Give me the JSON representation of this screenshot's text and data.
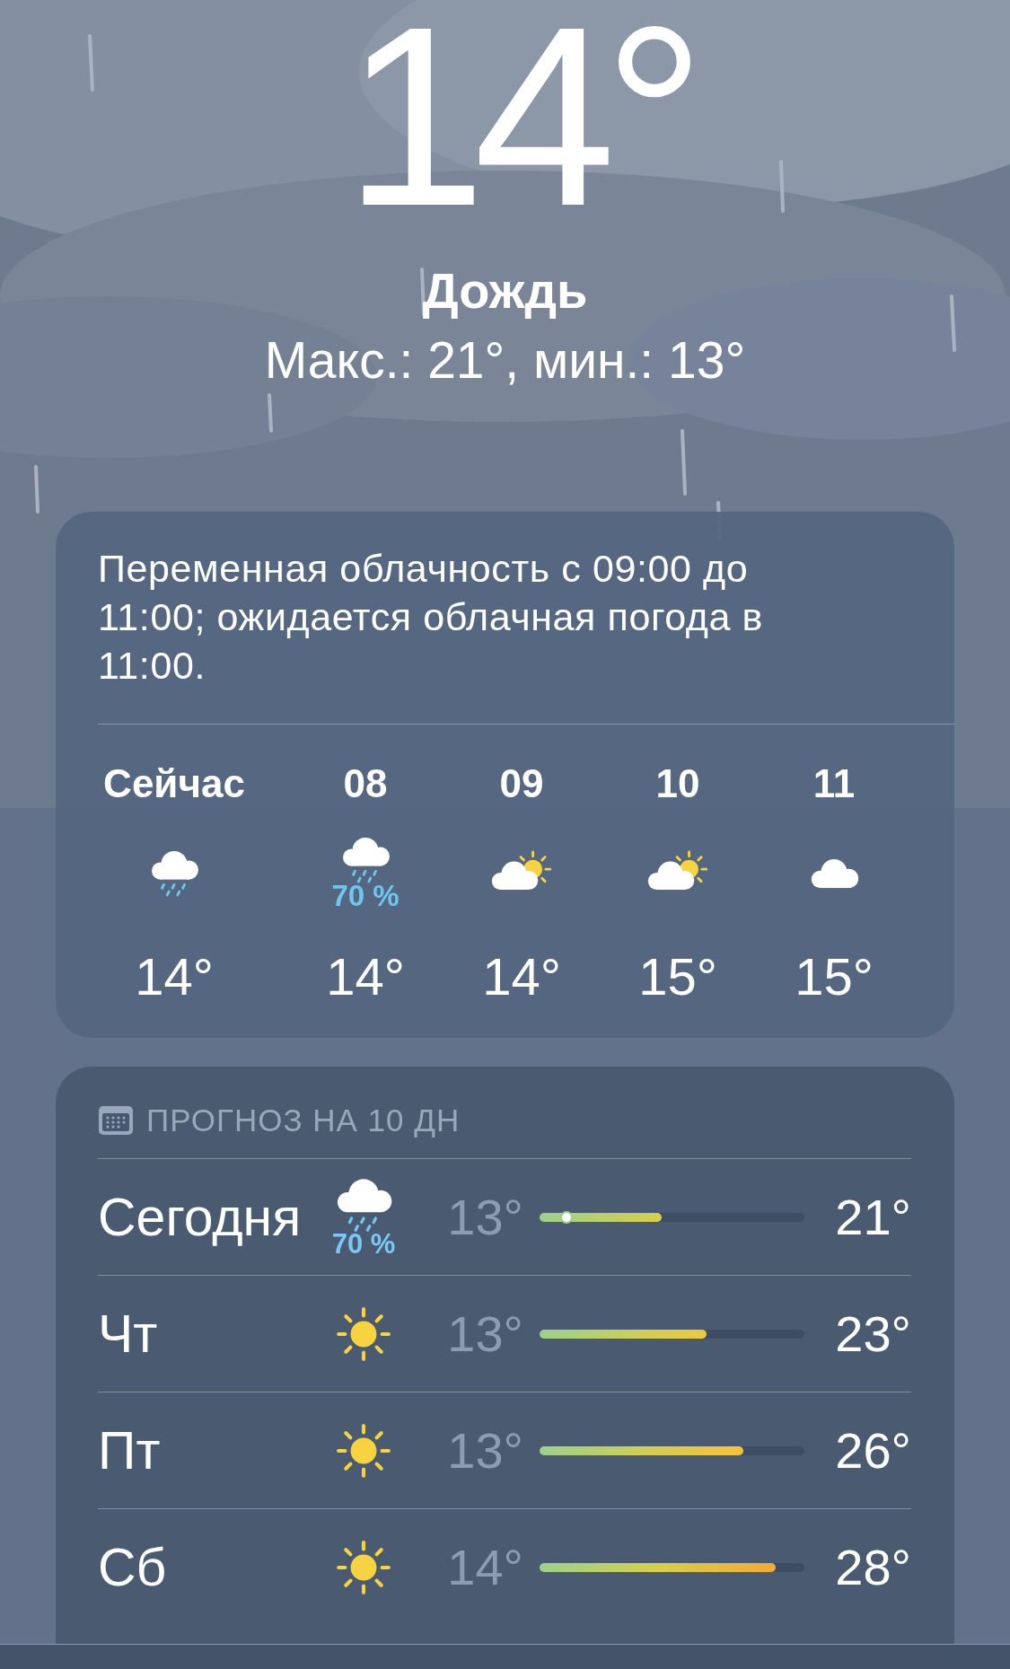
{
  "current": {
    "temperature": "14°",
    "condition": "Дождь",
    "high_low": "Макс.: 21°, мин.: 13°"
  },
  "hourly": {
    "summary": "Переменная облачность с 09:00 до 11:00; ожидается облачная погода в 11:00.",
    "hours": [
      {
        "time": "Сейчас",
        "kind": "rain",
        "temperature": "14°"
      },
      {
        "time": "08",
        "kind": "rain",
        "precipitation": "70 %",
        "temperature": "14°"
      },
      {
        "time": "09",
        "kind": "partly-sunny",
        "temperature": "14°"
      },
      {
        "time": "10",
        "kind": "partly-sunny",
        "temperature": "15°"
      },
      {
        "time": "11",
        "kind": "cloud",
        "temperature": "15°"
      }
    ]
  },
  "daily": {
    "title": "ПРОГНОЗ НА 10 ДН",
    "days": [
      {
        "day": "Сегодня",
        "kind": "rain",
        "precipitation": "70 %",
        "low": "13°",
        "high": "21°",
        "range_bar": {
          "level": 0.46
        },
        "current_dot": {
          "level": 0.1
        }
      },
      {
        "day": "Чт",
        "kind": "sun",
        "low": "13°",
        "high": "23°",
        "range_bar": {
          "level": 0.63
        }
      },
      {
        "day": "Пт",
        "kind": "sun",
        "low": "13°",
        "high": "26°",
        "range_bar": {
          "level": 0.77
        }
      },
      {
        "day": "Сб",
        "kind": "sun",
        "low": "14°",
        "high": "28°",
        "range_bar": {
          "level": 0.89
        }
      }
    ]
  }
}
